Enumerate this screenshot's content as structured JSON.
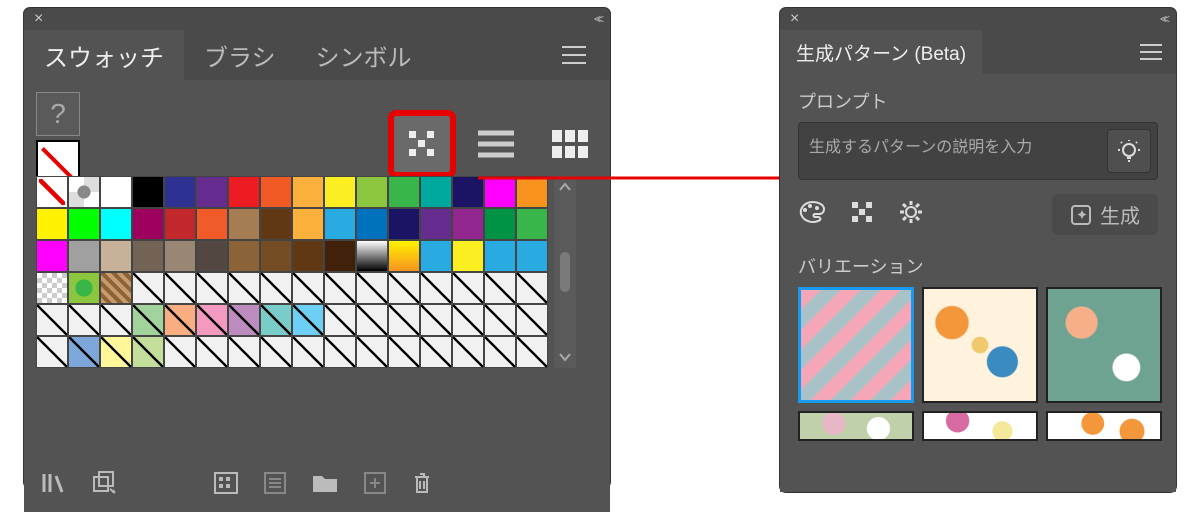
{
  "left_panel": {
    "tabs": [
      "スウォッチ",
      "ブラシ",
      "シンボル"
    ],
    "active_tab": 0,
    "help_label": "?",
    "view_buttons": [
      "generate-pattern",
      "list-view",
      "grid-view"
    ],
    "highlighted_view": "generate-pattern",
    "swatch_rows": [
      [
        "none",
        "reg",
        "#ffffff",
        "#000000",
        "#2e3192",
        "#662d91",
        "#ed1c24",
        "#f15a24",
        "#fbb03b",
        "#fcee21",
        "#8cc63f",
        "#39b54a",
        "#00a99d",
        "#1b1464",
        "#ff00ff",
        "#f7931e"
      ],
      [
        "#fff200",
        "#00ff00",
        "#00ffff",
        "#9e005d",
        "#c1272d",
        "#f15a29",
        "#a67c52",
        "#603813",
        "#fbb03b",
        "#29abe2",
        "#0071bc",
        "#1b1464",
        "#662d91",
        "#93278f",
        "#009245",
        "#39b54a"
      ],
      [
        "#ff00ff",
        "#a0a0a0",
        "#c7b299",
        "#736357",
        "#998675",
        "#534741",
        "#8c6239",
        "#754c24",
        "#603813",
        "#42210b",
        "grad-a",
        "grad-b",
        "#29abe2",
        "#fcee21",
        "#29abe2",
        "#29abe2"
      ],
      [
        "checker",
        "pattern-g",
        "pattern-h",
        "diag-b",
        "diag-b",
        "diag-b",
        "diag-b",
        "diag-b",
        "diag-b",
        "diag-b",
        "diag-b",
        "diag-b",
        "diag-b",
        "diag-b",
        "diag-b",
        "diag-b"
      ],
      [
        "diag-b",
        "diag-b",
        "diag-b",
        "diag-g",
        "diag-o",
        "diag-p",
        "diag-v",
        "diag-c",
        "diag-b2",
        "diag-b",
        "diag-b",
        "diag-b",
        "diag-b",
        "diag-b",
        "diag-b",
        "diag-b"
      ],
      [
        "diag-b",
        "diag-c2",
        "diag-y",
        "diag-g2",
        "diag-b",
        "diag-b",
        "diag-b",
        "diag-b",
        "diag-b",
        "diag-b",
        "diag-b",
        "diag-b",
        "diag-b",
        "diag-b",
        "diag-b",
        "diag-b"
      ]
    ],
    "swatch_colors": {
      "grad-a": "linear-gradient(#fff,#000)",
      "grad-b": "linear-gradient(#fff200,#f7931e)",
      "pattern-g": "radial-gradient(circle,#39b54a 0 40%,#8cc63f 41%)",
      "pattern-h": "repeating-linear-gradient(45deg,#c69c6d 0 4px,#8c6239 4px 8px)",
      "diag-b": "#f2f2f2",
      "diag-g": "#a3d39c",
      "diag-o": "#f9ad81",
      "diag-p": "#f49ac1",
      "diag-v": "#bd8cbf",
      "diag-c": "#7accc8",
      "diag-b2": "#6dcff6",
      "diag-c2": "#7da7d9",
      "diag-y": "#fff799",
      "diag-g2": "#c4df9b"
    },
    "footer_icons": [
      "library-icon",
      "add-to-lib-icon",
      "",
      "swatch-options-icon",
      "",
      "show-find-icon",
      "folder-icon",
      "new-swatch-icon",
      "delete-icon"
    ]
  },
  "right_panel": {
    "tab_title": "生成パターン (Beta)",
    "prompt_label": "プロンプト",
    "prompt_placeholder": "生成するパターンの説明を入力",
    "action_icons": [
      "palette-icon",
      "pattern-grid-icon",
      "gear-icon"
    ],
    "generate_label": "生成",
    "variation_label": "バリエーション",
    "thumbs": [
      "pattern-a",
      "pattern-b",
      "pattern-c",
      "pattern-d",
      "pattern-e",
      "pattern-f"
    ],
    "selected_thumb": 0
  },
  "colors": {
    "highlight": "#e60000",
    "panel_bg": "#4a4a4a",
    "panel_body": "#535353",
    "select_blue": "#179bf2"
  }
}
